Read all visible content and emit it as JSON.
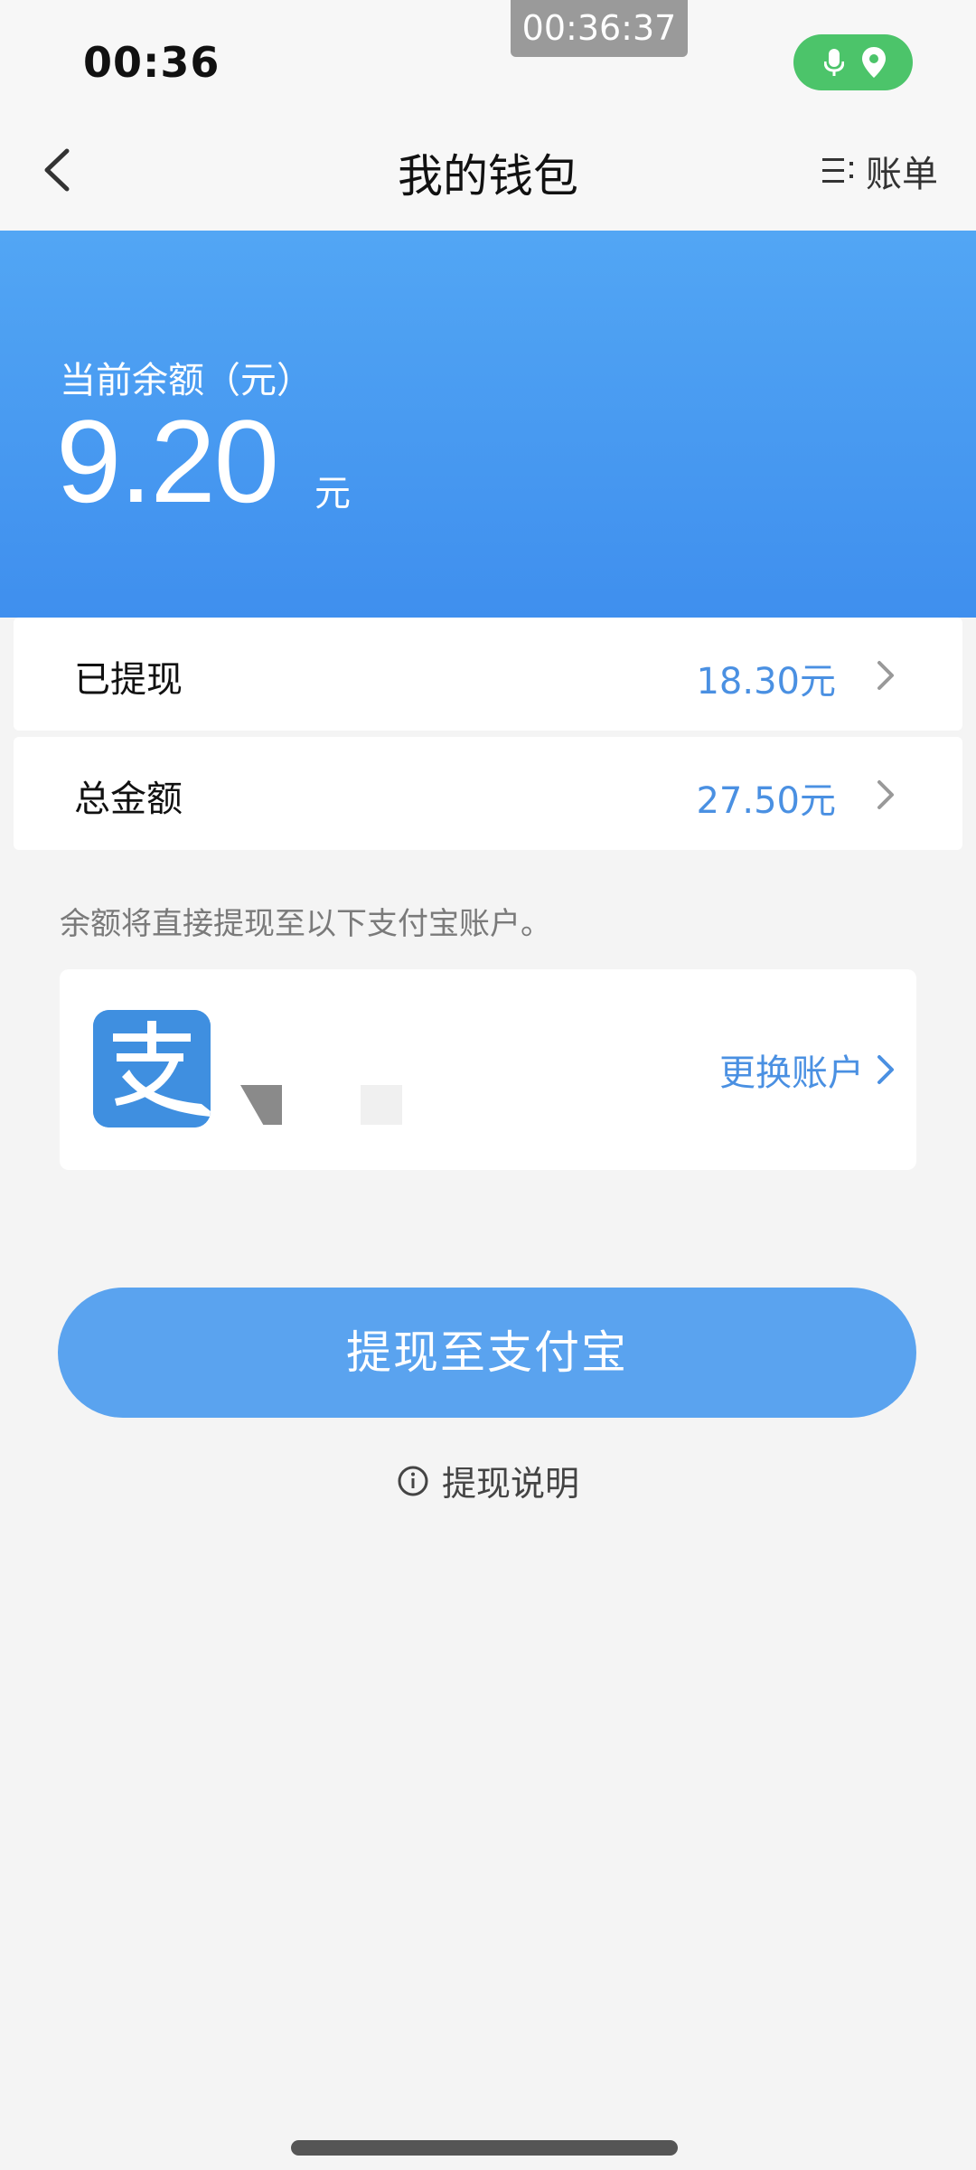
{
  "status_bar": {
    "time": "00:36",
    "recording_time": "00:36:37"
  },
  "nav": {
    "title": "我的钱包",
    "bill_label": "账单"
  },
  "balance": {
    "label": "当前余额（元）",
    "amount": "9.20",
    "unit": "元"
  },
  "rows": [
    {
      "label": "已提现",
      "value": "18.30元"
    },
    {
      "label": "总金额",
      "value": "27.50元"
    }
  ],
  "account": {
    "note": "余额将直接提现至以下支付宝账户。",
    "change_label": "更换账户"
  },
  "withdraw_button": "提现至支付宝",
  "withdraw_info": "提现说明",
  "colors": {
    "banner": "#4a9cf1",
    "accent_text": "#4a90e2",
    "button": "#5aa3ef",
    "indicator": "#4cc46a"
  }
}
